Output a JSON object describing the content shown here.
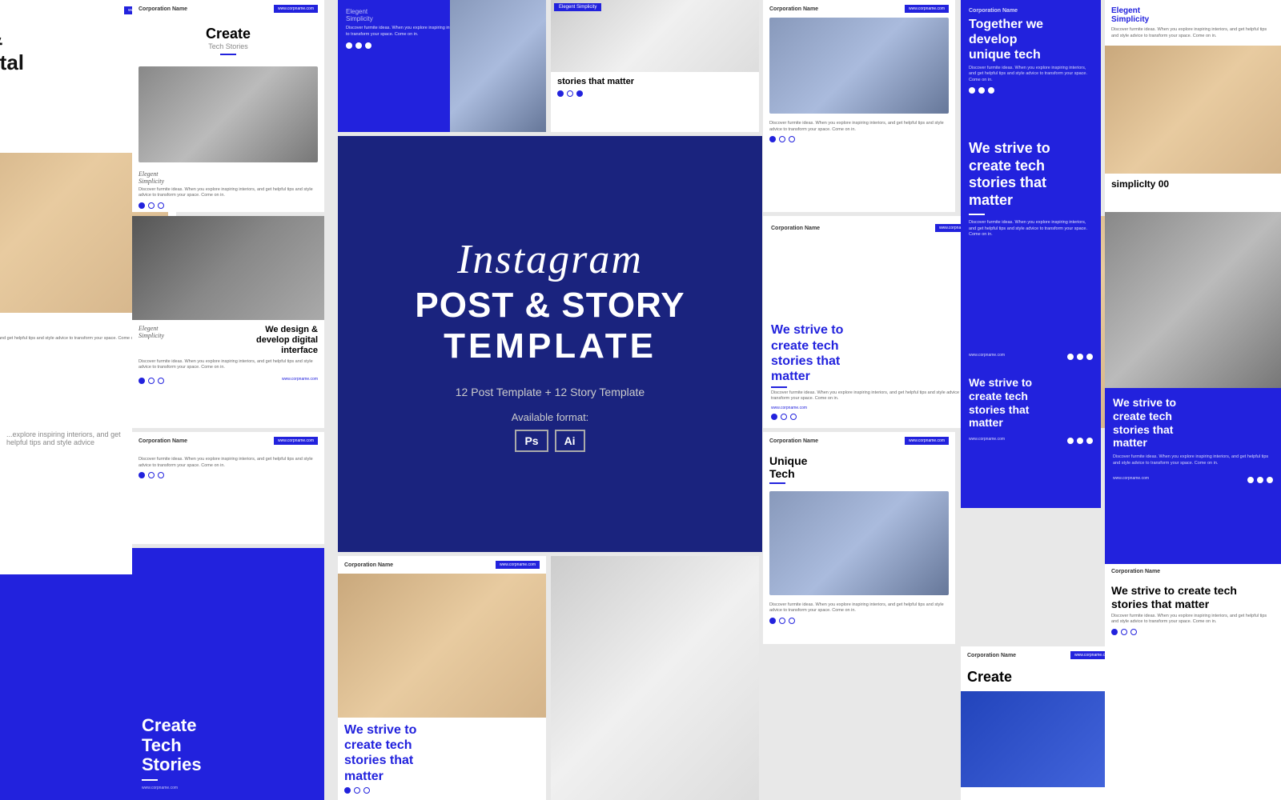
{
  "page": {
    "title": "Instagram Post & Story Template"
  },
  "center": {
    "script_text": "Instagram",
    "post_story": "POST & STORY",
    "template": "TEMPLATE",
    "subtitle": "12 Post Template + 12 Story Template",
    "format_label": "Available format:",
    "format_ps": "Ps",
    "format_ai": "Ai"
  },
  "cards": {
    "card1_title": "Create",
    "card1_sub": "Tech Stories",
    "card2_title": "We design & develop digital interface",
    "card3_title": "Elegent Simplicity",
    "card4_title": "We strive to create tech stories that matter",
    "card5_title": "Together we develop unique tech",
    "card6_title": "We design & develop digital interface",
    "corp_name": "Corporation Name",
    "website": "www.corpname.com",
    "desc": "Discover furmite ideas. When you explore inspiring interiors, and get helpful tips and style advice to transform your space. Come on in.",
    "unique_tech": "Unique Tech",
    "create_tech": "Create Tech Stories"
  }
}
